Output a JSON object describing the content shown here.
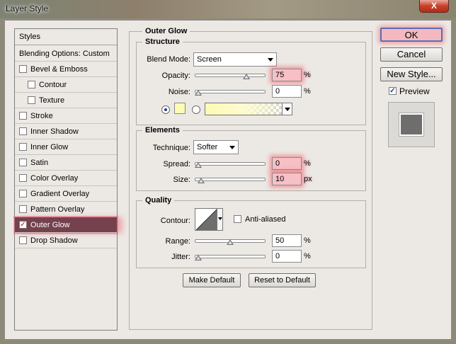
{
  "window": {
    "title": "Layer Style",
    "close_glyph": "X"
  },
  "styles_list": {
    "header": "Styles",
    "blending_options": "Blending Options: Custom",
    "effects": [
      {
        "label": "Bevel & Emboss",
        "checked": false,
        "indent": false
      },
      {
        "label": "Contour",
        "checked": false,
        "indent": true
      },
      {
        "label": "Texture",
        "checked": false,
        "indent": true
      },
      {
        "label": "Stroke",
        "checked": false,
        "indent": false
      },
      {
        "label": "Inner Shadow",
        "checked": false,
        "indent": false
      },
      {
        "label": "Inner Glow",
        "checked": false,
        "indent": false
      },
      {
        "label": "Satin",
        "checked": false,
        "indent": false
      },
      {
        "label": "Color Overlay",
        "checked": false,
        "indent": false
      },
      {
        "label": "Gradient Overlay",
        "checked": false,
        "indent": false
      },
      {
        "label": "Pattern Overlay",
        "checked": false,
        "indent": false
      },
      {
        "label": "Outer Glow",
        "checked": true,
        "indent": false,
        "selected": true
      },
      {
        "label": "Drop Shadow",
        "checked": false,
        "indent": false
      }
    ]
  },
  "outer_glow": {
    "title": "Outer Glow",
    "structure": {
      "title": "Structure",
      "blend_mode_label": "Blend Mode:",
      "blend_mode_value": "Screen",
      "opacity_label": "Opacity:",
      "opacity_value": "75",
      "opacity_fraction": 0.75,
      "opacity_unit": "%",
      "noise_label": "Noise:",
      "noise_value": "0",
      "noise_fraction": 0.0,
      "noise_unit": "%",
      "glow_color": "#fefbb4"
    },
    "elements": {
      "title": "Elements",
      "technique_label": "Technique:",
      "technique_value": "Softer",
      "spread_label": "Spread:",
      "spread_value": "0",
      "spread_fraction": 0.0,
      "spread_unit": "%",
      "size_label": "Size:",
      "size_value": "10",
      "size_fraction": 0.04,
      "size_unit": "px"
    },
    "quality": {
      "title": "Quality",
      "contour_label": "Contour:",
      "anti_aliased_label": "Anti-aliased",
      "anti_aliased_checked": false,
      "range_label": "Range:",
      "range_value": "50",
      "range_fraction": 0.5,
      "range_unit": "%",
      "jitter_label": "Jitter:",
      "jitter_value": "0",
      "jitter_fraction": 0.0,
      "jitter_unit": "%"
    },
    "make_default_label": "Make Default",
    "reset_default_label": "Reset to Default"
  },
  "actions": {
    "ok_label": "OK",
    "cancel_label": "Cancel",
    "new_style_label": "New Style...",
    "preview_label": "Preview",
    "preview_checked": true
  },
  "colors": {
    "selection_bg": "#74414d",
    "highlight": "#f07080",
    "preview_swatch": "#6e6e6e"
  }
}
